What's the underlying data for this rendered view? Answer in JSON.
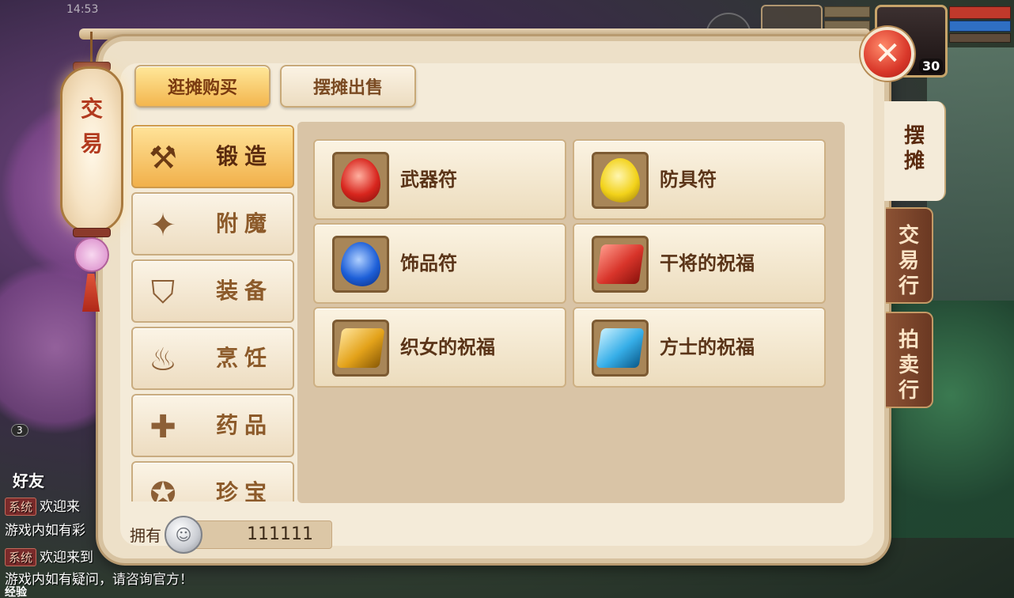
{
  "status_bar": {
    "time": "14:53"
  },
  "hud": {
    "level": "30"
  },
  "chat": {
    "friends_count": "3",
    "friends_label": "好友",
    "lines": [
      {
        "tag": "系统",
        "text": "欢迎来"
      },
      {
        "tag": "",
        "text": "游戏内如有彩"
      },
      {
        "tag": "系统",
        "text": "欢迎来到"
      },
      {
        "tag": "",
        "text": "游戏内如有疑问，请咨询官方！"
      }
    ],
    "exp_label": "经验"
  },
  "lantern": {
    "line1": "交",
    "line2": "易"
  },
  "tabs": {
    "buy": "逛摊购买",
    "sell": "摆摊出售"
  },
  "categories": [
    {
      "label": "锻造",
      "icon": "hammer-icon",
      "glyph": "⚒"
    },
    {
      "label": "附魔",
      "icon": "magic-wand-icon",
      "glyph": "✦"
    },
    {
      "label": "装备",
      "icon": "armor-icon",
      "glyph": "⛉"
    },
    {
      "label": "烹饪",
      "icon": "cooking-pot-icon",
      "glyph": "♨"
    },
    {
      "label": "药品",
      "icon": "medicine-icon",
      "glyph": "✚"
    },
    {
      "label": "珍宝",
      "icon": "treasure-icon",
      "glyph": "✪"
    }
  ],
  "items": [
    {
      "label": "武器符",
      "icon": "red-talisman-icon",
      "color": "#d8261e"
    },
    {
      "label": "防具符",
      "icon": "yellow-talisman-icon",
      "color": "#f2d21a"
    },
    {
      "label": "饰品符",
      "icon": "blue-talisman-icon",
      "color": "#1d5fd8"
    },
    {
      "label": "干将的祝福",
      "icon": "red-scroll-icon",
      "color": "#d8342a"
    },
    {
      "label": "织女的祝福",
      "icon": "gold-scroll-icon",
      "color": "#e3a21a"
    },
    {
      "label": "方士的祝福",
      "icon": "cyan-scroll-icon",
      "color": "#36aee8"
    }
  ],
  "currency": {
    "label": "拥有",
    "value": "111111",
    "icon": "silver-coin-icon"
  },
  "side_tabs": {
    "stall": "摆摊",
    "trade": "交易行",
    "auction": "拍卖行"
  },
  "colors": {
    "accent": "#f3b64e",
    "panel": "#f4ebd9",
    "close": "#d9382a"
  }
}
